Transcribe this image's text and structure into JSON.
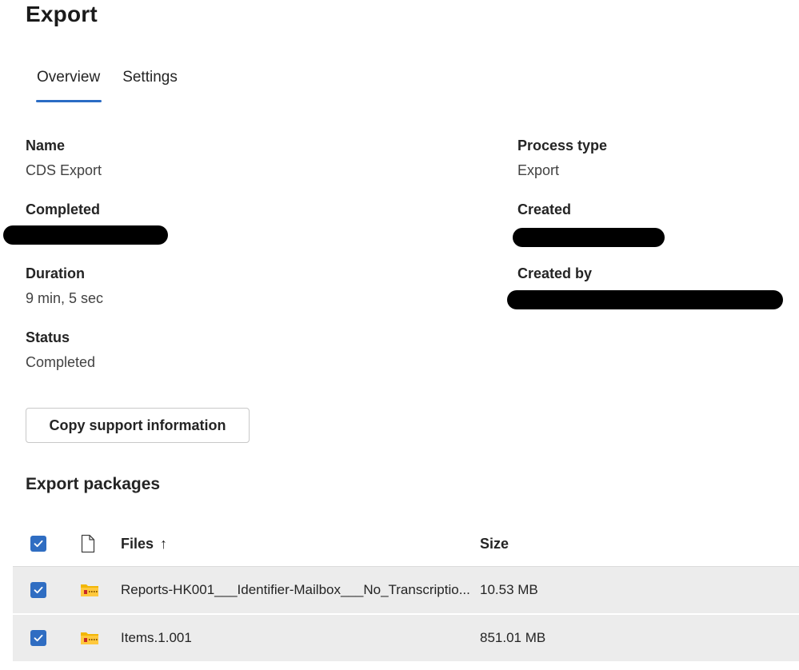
{
  "page": {
    "title": "Export"
  },
  "tabs": [
    {
      "label": "Overview",
      "active": true
    },
    {
      "label": "Settings",
      "active": false
    }
  ],
  "details": {
    "name": {
      "label": "Name",
      "value": "CDS Export"
    },
    "process_type": {
      "label": "Process type",
      "value": "Export"
    },
    "completed": {
      "label": "Completed"
    },
    "created": {
      "label": "Created"
    },
    "duration": {
      "label": "Duration",
      "value": "9 min, 5 sec"
    },
    "created_by": {
      "label": "Created by"
    },
    "status": {
      "label": "Status",
      "value": "Completed"
    }
  },
  "actions": {
    "copy_support_label": "Copy support information"
  },
  "packages": {
    "title": "Export packages",
    "columns": {
      "files": "Files",
      "files_sort": "↑",
      "size": "Size"
    },
    "rows": [
      {
        "name": "Reports-HK001___Identifier-Mailbox___No_Transcriptio...",
        "size": "10.53 MB",
        "selected": true
      },
      {
        "name": "Items.1.001",
        "size": "851.01 MB",
        "selected": true
      }
    ]
  },
  "colors": {
    "accent": "#2f6dc2",
    "tab_underline": "#2b6cc4",
    "selected_row": "#ececec",
    "folder": "#f2b705"
  },
  "icons": {
    "file_column": "file-icon",
    "package": "zip-folder-icon",
    "checkbox": "checkmark-icon"
  }
}
